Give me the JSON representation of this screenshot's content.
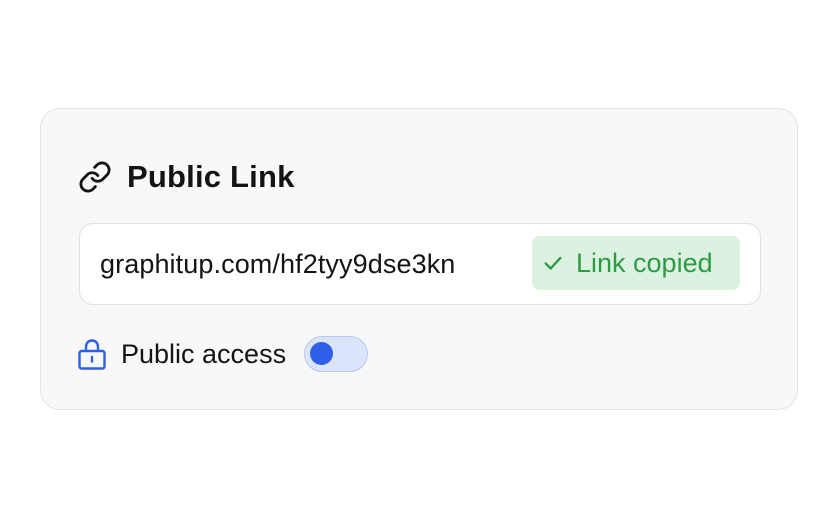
{
  "card": {
    "title": "Public Link",
    "link_icon": "link-icon",
    "link": {
      "url": "graphitup.com/hf2tyy9dse3kn",
      "copied_label": "Link copied",
      "copied_icon": "check-icon"
    },
    "access": {
      "label": "Public access",
      "lock_icon": "lock-icon",
      "toggle_on": false
    }
  },
  "colors": {
    "accent": "#2f5ee8",
    "success_text": "#2e9a48",
    "success_bg": "#dcf2e0",
    "card_bg": "#f8f8f8"
  }
}
